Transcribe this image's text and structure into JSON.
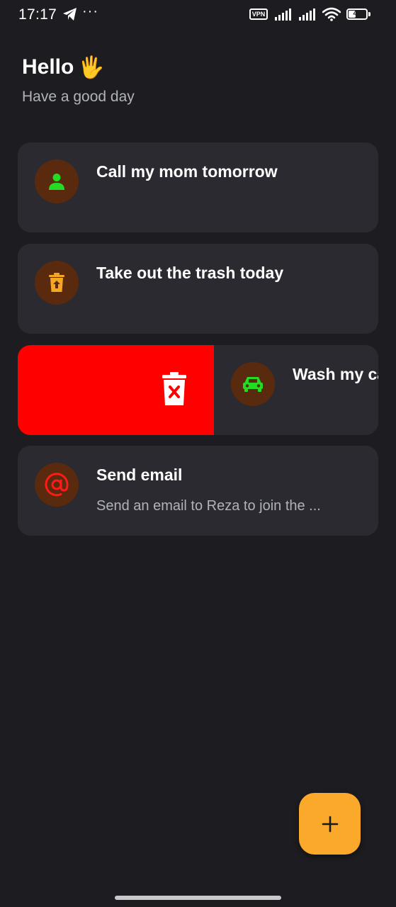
{
  "status_bar": {
    "time": "17:17",
    "more": "···",
    "vpn": "VPN",
    "battery": "43",
    "battery_level": 0.43
  },
  "header": {
    "greeting": "Hello",
    "wave_emoji": "🖐",
    "subtitle": "Have a good day"
  },
  "tasks": [
    {
      "title": "Call my mom tomorrow",
      "description": "",
      "icon": "person-icon",
      "icon_color": "#22dd22"
    },
    {
      "title": "Take out the trash today",
      "description": "",
      "icon": "trash-icon",
      "icon_color": "#f5a623"
    },
    {
      "title": "Wash my car",
      "description": "",
      "icon": "car-icon",
      "icon_color": "#22dd22",
      "swiped": true
    },
    {
      "title": "Send email",
      "description": "Send an email to Reza to join the ...",
      "icon": "at-icon",
      "icon_color": "#ff1a1a"
    }
  ],
  "swipe_action": {
    "label": "delete",
    "color": "#ff0000",
    "icon": "delete-icon"
  },
  "fab": {
    "icon": "plus-icon",
    "color": "#fba92b"
  },
  "colors": {
    "background": "#1d1c20",
    "card": "#2b2a30",
    "icon_bg": "#5a2a0e",
    "secondary_text": "#b0b4ba"
  }
}
